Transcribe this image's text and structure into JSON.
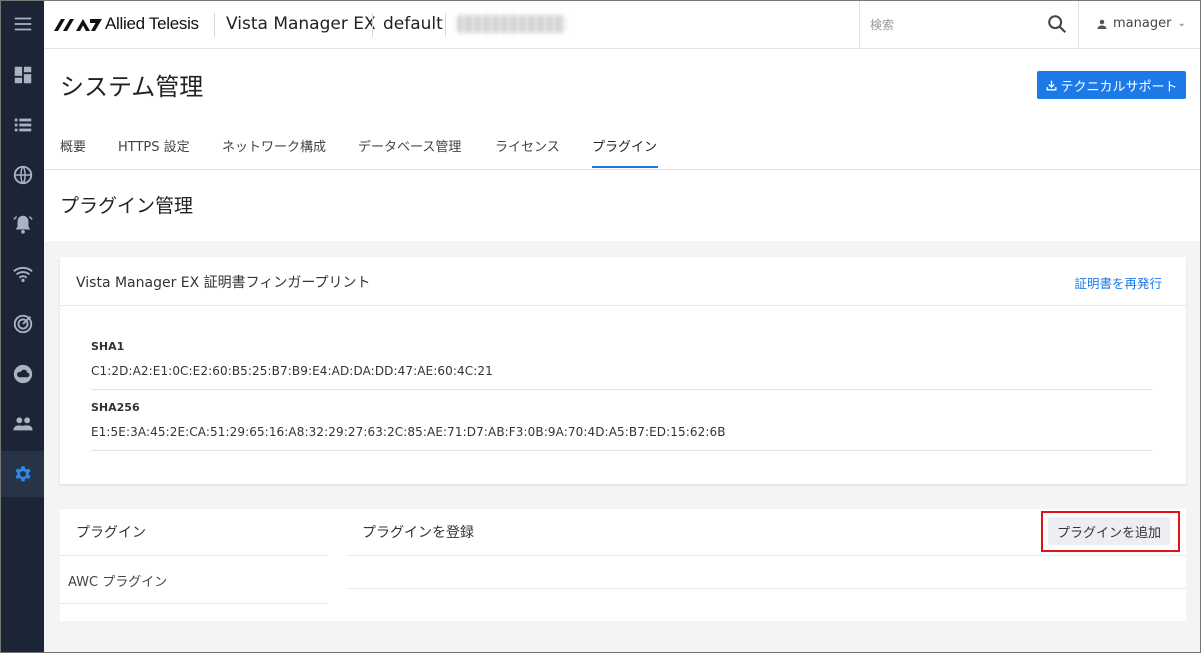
{
  "header": {
    "logo_text": "Allied Telesis",
    "app_name": "Vista Manager EX",
    "workspace": "default",
    "search_placeholder": "検索",
    "user": "manager"
  },
  "page": {
    "title": "システム管理",
    "support_button": "テクニカルサポート"
  },
  "tabs": [
    {
      "label": "概要"
    },
    {
      "label": "HTTPS 設定"
    },
    {
      "label": "ネットワーク構成"
    },
    {
      "label": "データベース管理"
    },
    {
      "label": "ライセンス"
    },
    {
      "label": "プラグイン"
    }
  ],
  "section": {
    "title": "プラグイン管理"
  },
  "fingerprint": {
    "title": "Vista Manager EX 証明書フィンガープリント",
    "reissue_link": "証明書を再発行",
    "sha1_label": "SHA1",
    "sha1_value": "C1:2D:A2:E1:0C:E2:60:B5:25:B7:B9:E4:AD:DA:DD:47:AE:60:4C:21",
    "sha256_label": "SHA256",
    "sha256_value": "E1:5E:3A:45:2E:CA:51:29:65:16:A8:32:29:27:63:2C:85:AE:71:D7:AB:F3:0B:9A:70:4D:A5:B7:ED:15:62:6B"
  },
  "plugins": {
    "list_title": "プラグイン",
    "items": [
      {
        "label": "AWC プラグイン"
      }
    ],
    "register_title": "プラグインを登録",
    "add_button": "プラグインを追加"
  },
  "sidebar": {
    "items": [
      {
        "icon": "menu-icon"
      },
      {
        "icon": "dashboard-icon"
      },
      {
        "icon": "list-icon"
      },
      {
        "icon": "globe-icon"
      },
      {
        "icon": "alarm-icon"
      },
      {
        "icon": "wifi-icon"
      },
      {
        "icon": "radar-icon"
      },
      {
        "icon": "cloud-icon"
      },
      {
        "icon": "people-icon"
      },
      {
        "icon": "gear-icon",
        "active": true
      }
    ]
  },
  "colors": {
    "accent": "#1c7ae8",
    "sidebar_bg": "#1b2535",
    "highlight": "#e01414"
  }
}
